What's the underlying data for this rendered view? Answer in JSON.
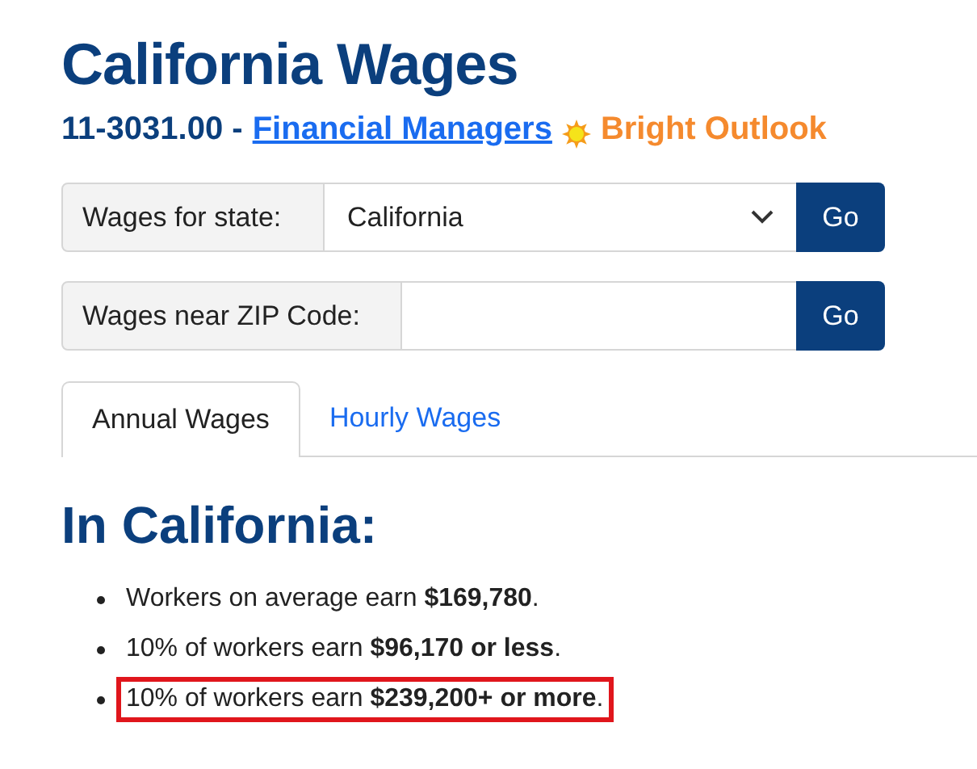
{
  "title": "California Wages",
  "subtitle": {
    "code": "11-3031.00 -",
    "occupation": "Financial Managers",
    "badge": "Bright Outlook"
  },
  "forms": [
    {
      "kind": "select",
      "label": "Wages for state:",
      "value": "California",
      "button": "Go"
    },
    {
      "kind": "input",
      "label": "Wages near ZIP Code:",
      "button": "Go"
    }
  ],
  "tabs": [
    {
      "label": "Annual Wages",
      "selected": true
    },
    {
      "label": "Hourly Wages",
      "selected": false
    }
  ],
  "section_title": "In California:",
  "facts": [
    {
      "text": "Workers on average earn **$169,780**.",
      "highlighted": false
    },
    {
      "text": "10% of workers earn **$96,170 or less**.",
      "highlighted": false
    },
    {
      "text": "10% of workers earn **$239,200+ or more**.",
      "highlighted": true
    }
  ]
}
